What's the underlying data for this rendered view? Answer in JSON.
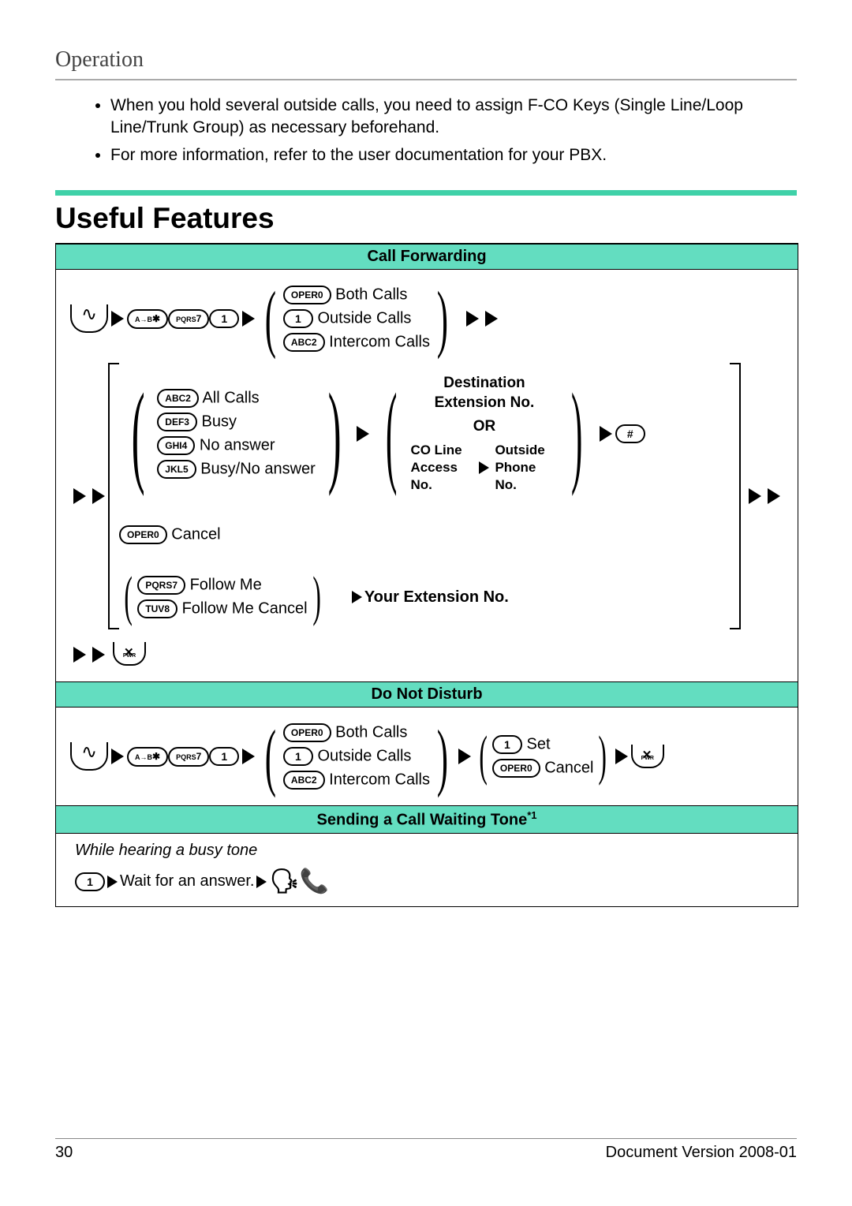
{
  "header": {
    "title": "Operation"
  },
  "intro_bullets": [
    "When you hold several outside calls, you need to assign F-CO Keys (Single Line/Loop Line/Trunk Group) as necessary beforehand.",
    "For more information, refer to the user documentation for your PBX."
  ],
  "h1": "Useful Features",
  "sections": {
    "call_forwarding": {
      "title": "Call Forwarding",
      "first_group": {
        "keys": [
          "*",
          "7",
          "1"
        ],
        "options": [
          {
            "key": "0",
            "key_sub": "OPER",
            "label": "Both Calls"
          },
          {
            "key": "1",
            "key_sub": "",
            "label": "Outside Calls"
          },
          {
            "key": "2",
            "key_sub": "ABC",
            "label": "Intercom Calls"
          }
        ]
      },
      "type_options": [
        {
          "key": "2",
          "key_sub": "ABC",
          "label": "All Calls"
        },
        {
          "key": "3",
          "key_sub": "DEF",
          "label": "Busy"
        },
        {
          "key": "4",
          "key_sub": "GHI",
          "label": "No answer"
        },
        {
          "key": "5",
          "key_sub": "JKL",
          "label": "Busy/No answer"
        }
      ],
      "cancel": {
        "key": "0",
        "key_sub": "OPER",
        "label": "Cancel"
      },
      "follow": [
        {
          "key": "7",
          "key_sub": "PQRS",
          "label": "Follow Me"
        },
        {
          "key": "8",
          "key_sub": "TUV",
          "label": "Follow Me Cancel"
        }
      ],
      "dest": {
        "line1": "Destination",
        "line2": "Extension No.",
        "or": "OR",
        "co": "CO Line Access No.",
        "outside": "Outside Phone No."
      },
      "your_ext": "Your Extension No.",
      "end_key": "#"
    },
    "dnd": {
      "title": "Do Not Disturb",
      "keys": [
        "*",
        "7",
        "1"
      ],
      "call_opts": [
        {
          "key": "0",
          "key_sub": "OPER",
          "label": "Both Calls"
        },
        {
          "key": "1",
          "key_sub": "",
          "label": "Outside Calls"
        },
        {
          "key": "2",
          "key_sub": "ABC",
          "label": "Intercom Calls"
        }
      ],
      "set_opts": [
        {
          "key": "1",
          "key_sub": "",
          "label": "Set"
        },
        {
          "key": "0",
          "key_sub": "OPER",
          "label": "Cancel"
        }
      ]
    },
    "cwt": {
      "title": "Sending a Call Waiting Tone",
      "note": "*1",
      "condition": "While hearing a busy tone",
      "key": "1",
      "wait": "Wait for an answer."
    }
  },
  "footer": {
    "page": "30",
    "version": "Document Version 2008-01"
  }
}
